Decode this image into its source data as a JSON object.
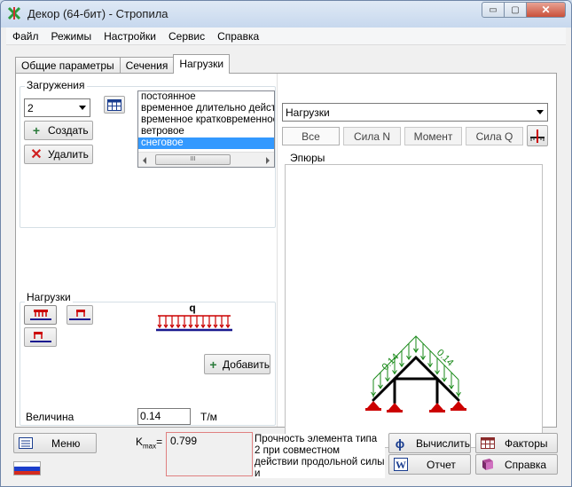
{
  "window": {
    "title": "Декор (64-бит) - Стропила",
    "min_glyph": "▭",
    "max_glyph": "▢",
    "close_glyph": "✕"
  },
  "menu": [
    "Файл",
    "Режимы",
    "Настройки",
    "Сервис",
    "Справка"
  ],
  "tabs": [
    "Общие параметры",
    "Сечения",
    "Нагрузки"
  ],
  "active_tab": "Нагрузки",
  "loadings": {
    "group_label": "Загружения",
    "selected": "2",
    "create_label": "Создать",
    "delete_label": "Удалить",
    "list": [
      "постоянное",
      "временное длительно действу",
      "временное кратковременное",
      "ветровое",
      "снеговое"
    ],
    "selected_item": "снеговое",
    "scroll_thumb_text": "III"
  },
  "loads": {
    "group_label": "Нагрузки",
    "q_label": "q",
    "add_label": "Добавить",
    "value_label": "Величина",
    "value": "0.14",
    "unit": "Т/м"
  },
  "right_panel": {
    "dropdown_value": "Нагрузки",
    "view_tabs": [
      "Все",
      "Сила N",
      "Момент",
      "Сила Q"
    ],
    "active_view": "Все",
    "diagrams_label": "Эпюры",
    "diagram_labels": [
      "0.14",
      "0.14"
    ]
  },
  "bottom": {
    "menu_label": "Меню",
    "kmax_label": "K",
    "kmax_sub": "max",
    "kmax_eq": "=",
    "kmax_value": "0.799",
    "strength_text": "Прочность элемента типа 2 при совместном действии продольной силы и",
    "calc_label": "Вычислить",
    "factors_label": "Факторы",
    "report_label": "Отчет",
    "help_label": "Справка"
  },
  "colors": {
    "selection": "#3399ff",
    "load_red": "#cc0000",
    "diagram_green": "#1a8a1a"
  }
}
